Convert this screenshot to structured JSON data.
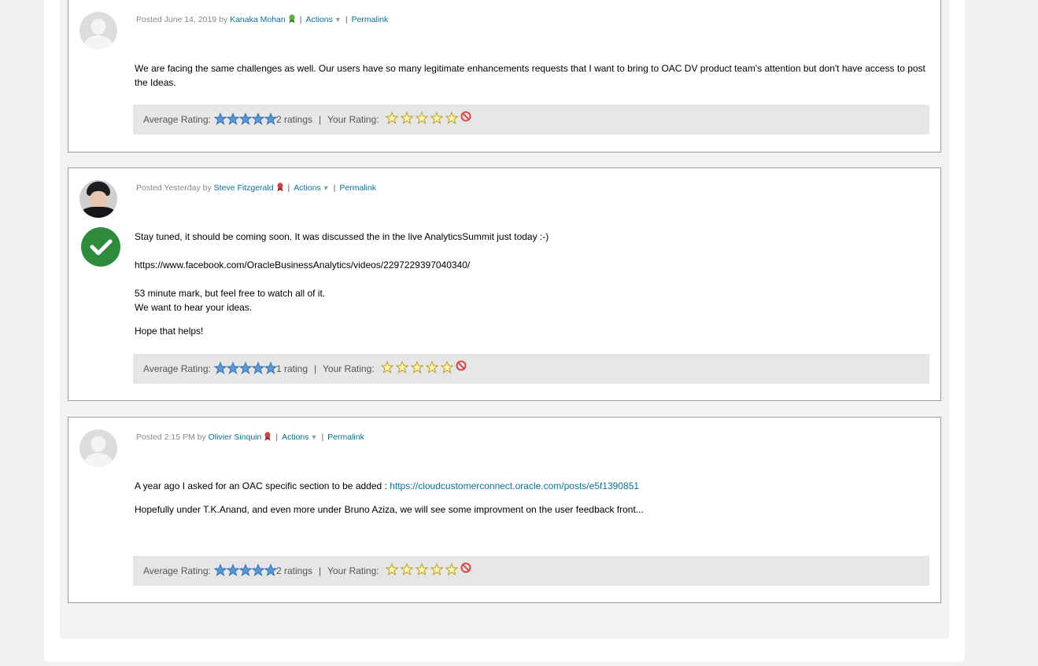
{
  "posts": [
    {
      "posted_prefix": "Posted June 14, 2019 by",
      "author": "Kanaka Mohan",
      "badge_color": "#5fae3e",
      "actions": "Actions",
      "permalink": "Permalink",
      "body": [
        "We are facing the same challenges as well. Our users have so many legitimate enhancements requests that I want to bring to OAC DV product team's attention but don't have access to post the Ideas."
      ],
      "average_rating_label": "Average Rating:",
      "rating_count": "2 ratings",
      "separator": "|",
      "your_rating_label": "Your Rating:"
    },
    {
      "posted_prefix": "Posted Yesterday by",
      "author": "Steve Fitzgerald",
      "badge_color": "#c94a4a",
      "actions": "Actions",
      "permalink": "Permalink",
      "accepted_icon": "check-circle-icon",
      "body": [
        "Stay tuned, it should be coming soon. It was discussed the in the live AnalyticsSummit  just today :-)",
        "https://www.facebook.com/OracleBusinessAnalytics/videos/2297229397040340/",
        "53 minute mark, but feel free to watch all of it.",
        "We want to hear your ideas.",
        "Hope that helps!"
      ],
      "average_rating_label": "Average Rating:",
      "rating_count": "1 rating",
      "separator": "|",
      "your_rating_label": "Your Rating:"
    },
    {
      "posted_prefix": "Posted 2:15 PM by",
      "author": "Olivier Sinquin",
      "badge_color": "#c94a4a",
      "actions": "Actions",
      "permalink": "Permalink",
      "body_line1_text": "A year ago I asked for an OAC specific section to be added : ",
      "body_line1_link": "https://cloudcustomerconnect.oracle.com/posts/e5f1390851",
      "body_line2": "Hopefully under T.K.Anand, and even more under Bruno Aziza, we will see some improvment on the user feedback front...",
      "average_rating_label": "Average Rating:",
      "rating_count": "2 ratings",
      "separator": "|",
      "your_rating_label": "Your Rating:"
    }
  ],
  "colors": {
    "link": "#0a6f9a",
    "accepted": "#2e8b3e",
    "avg_star": "#5b97d6",
    "your_star": "#f3d331"
  }
}
